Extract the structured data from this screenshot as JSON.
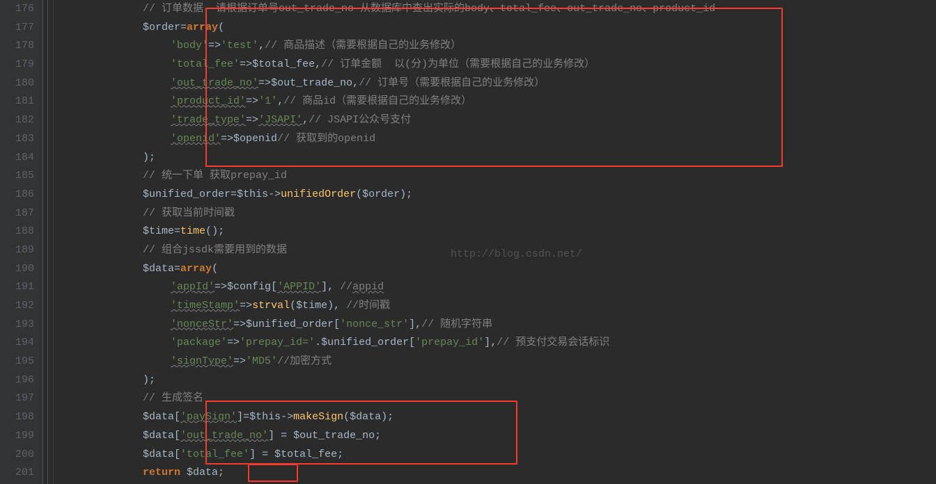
{
  "line_numbers": [
    "176",
    "177",
    "178",
    "179",
    "180",
    "181",
    "182",
    "183",
    "184",
    "185",
    "186",
    "187",
    "188",
    "189",
    "190",
    "191",
    "192",
    "193",
    "194",
    "195",
    "196",
    "197",
    "198",
    "199",
    "200",
    "201"
  ],
  "watermark": "http://blog.csdn.net/",
  "l176": {
    "c0": "// 订单数据  请根据订单号out_trade_no 从数据库中查出实际的body、total_fee、out_trade_no、product_id"
  },
  "l177": {
    "v": "$order",
    "eq": "=",
    "kw": "array",
    "p": "("
  },
  "l178": {
    "k": "'body'",
    "arr": "=>",
    "val": "'test'",
    "cm": ",",
    "c": "// 商品描述（需要根据自己的业务修改）"
  },
  "l179": {
    "k": "'total_fee'",
    "arr": "=>",
    "var": "$total_fee",
    "cm": ",",
    "c": "// 订单金额  以(分)为单位（需要根据自己的业务修改）"
  },
  "l180": {
    "k": "'out_trade_no'",
    "arr": "=>",
    "var": "$out_trade_no",
    "cm": ",",
    "c": "// 订单号（需要根据自己的业务修改）"
  },
  "l181": {
    "k": "'product_id'",
    "arr": "=>",
    "val": "'1'",
    "cm": ",",
    "c": "// 商品id（需要根据自己的业务修改）"
  },
  "l182": {
    "k": "'trade_type'",
    "arr": "=>",
    "val": "'JSAPI'",
    "cm": ",",
    "c": "// JSAPI公众号支付"
  },
  "l183": {
    "k": "'openid'",
    "arr": "=>",
    "var": "$openid",
    "c": "// 获取到的openid"
  },
  "l184": {
    "p": ");"
  },
  "l185": {
    "c": "// 统一下单 获取prepay_id"
  },
  "l186": {
    "v": "$unified_order",
    "eq": "=",
    "this": "$this",
    "arrow": "->",
    "fn": "unifiedOrder",
    "p1": "(",
    "arg": "$order",
    "p2": ");"
  },
  "l187": {
    "c": "// 获取当前时间戳"
  },
  "l188": {
    "v": "$time",
    "eq": "=",
    "fn": "time",
    "p": "();"
  },
  "l189": {
    "c": "// 组合jssdk需要用到的数据"
  },
  "l190": {
    "v": "$data",
    "eq": "=",
    "kw": "array",
    "p": "("
  },
  "l191": {
    "k": "'appId'",
    "arr": "=>",
    "var": "$config",
    "idx": "[",
    "key": "'APPID'",
    "idx2": "]",
    "cm": ", ",
    "c": "//",
    "u": "appid"
  },
  "l192": {
    "k": "'timeStamp'",
    "arr": "=>",
    "fn": "strval",
    "p1": "(",
    "arg": "$time",
    "p2": ")",
    "cm": ", ",
    "c": "//时间戳"
  },
  "l193": {
    "k": "'nonceStr'",
    "arr": "=>",
    "var": "$unified_order",
    "idx": "[",
    "key": "'nonce_str'",
    "idx2": "]",
    "cm": ",",
    "c": "// 随机字符串"
  },
  "l194": {
    "k": "'package'",
    "arr": "=>",
    "val": "'prepay_id='",
    "dot": ".",
    "var": "$unified_order",
    "idx": "[",
    "key": "'prepay_id'",
    "idx2": "]",
    "cm": ",",
    "c": "// 预支付交易会话标识"
  },
  "l195": {
    "k": "'signType'",
    "arr": "=>",
    "val": "'MD5'",
    "c": "//加密方式"
  },
  "l196": {
    "p": ");"
  },
  "l197": {
    "c": "// 生成签名"
  },
  "l198": {
    "v": "$data",
    "idx": "[",
    "key": "'paySign'",
    "idx2": "]",
    "eq": "=",
    "this": "$this",
    "arrow": "->",
    "fn": "makeSign",
    "p1": "(",
    "arg": "$data",
    "p2": ");"
  },
  "l199": {
    "v": "$data",
    "idx": "[",
    "key": "'out_trade_no'",
    "idx2": "]",
    "eq": " = ",
    "var": "$out_trade_no",
    "sc": ";"
  },
  "l200": {
    "v": "$data",
    "idx": "[",
    "key": "'total_fee'",
    "idx2": "]",
    "eq": " = ",
    "var": "$total_fee",
    "sc": ";"
  },
  "l201": {
    "kw": "return ",
    "v": "$data",
    "sc": ";"
  }
}
